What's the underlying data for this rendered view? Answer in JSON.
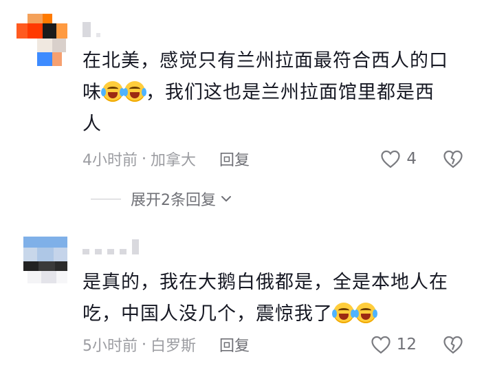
{
  "comments": [
    {
      "text_line1": "在北美，感觉只有兰州拉面最符合西人的口",
      "text_line2_prefix": "味",
      "text_line2_suffix": "，我们这也是兰州拉面馆里都是西",
      "text_line3": "人",
      "emojis": [
        "laughing-crying-emoji",
        "laughing-crying-emoji"
      ],
      "time": "4小时前",
      "separator": "·",
      "location": "加拿大",
      "reply_label": "回复",
      "like_count": "4",
      "expand_label": "展开2条回复"
    },
    {
      "text_line1": "是真的，我在大鹅白俄都是，全是本地人在",
      "text_line2_prefix": "吃，中国人没几个，震惊我了",
      "emojis": [
        "crying-emoji",
        "crying-emoji"
      ],
      "time": "5小时前",
      "separator": "·",
      "location": "白罗斯",
      "reply_label": "回复",
      "like_count": "12"
    }
  ],
  "colors": {
    "text": "#161823",
    "meta": "#8a8b91",
    "emoji": "#ffcd3c"
  }
}
